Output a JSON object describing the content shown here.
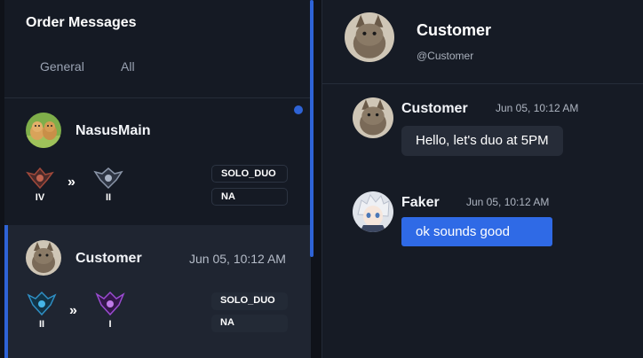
{
  "inbox": {
    "title": "Order Messages",
    "tabs": [
      {
        "label": "General"
      },
      {
        "label": "All"
      }
    ]
  },
  "conversations": [
    {
      "name": "NasusMain",
      "avatar": "dogs-photo",
      "unread": true,
      "from_rank": {
        "label": "IV",
        "icon": "bronze-emblem-icon",
        "color": "#a0483a"
      },
      "to_rank": {
        "label": "II",
        "icon": "silver-emblem-icon",
        "color": "#8a95a8"
      },
      "arrow": "»",
      "queue": "SOLO_DUO",
      "region": "NA"
    },
    {
      "name": "Customer",
      "time": "Jun 05, 10:12 AM",
      "avatar": "cat-photo",
      "selected": true,
      "from_rank": {
        "label": "II",
        "icon": "diamond-emblem-icon",
        "color": "#2f8fc4"
      },
      "to_rank": {
        "label": "I",
        "icon": "master-emblem-icon",
        "color": "#9a4bd0"
      },
      "arrow": "»",
      "queue": "SOLO_DUO",
      "region": "NA"
    }
  ],
  "chat": {
    "header": {
      "name": "Customer",
      "handle": "@Customer",
      "avatar": "cat-photo"
    },
    "messages": [
      {
        "author": "Customer",
        "time": "Jun 05, 10:12 AM",
        "text": "Hello, let's duo at 5PM",
        "avatar": "cat-photo",
        "outgoing": false
      },
      {
        "author": "Faker",
        "time": "Jun 05, 10:12 AM",
        "text": "ok sounds good",
        "avatar": "anime-avatar",
        "outgoing": true
      }
    ]
  },
  "colors": {
    "accent": "#2e63d6",
    "bubble_out": "#2f6ae6",
    "bubble_in": "#262c38",
    "panel": "#151a24",
    "selected_row": "#1f2531"
  }
}
